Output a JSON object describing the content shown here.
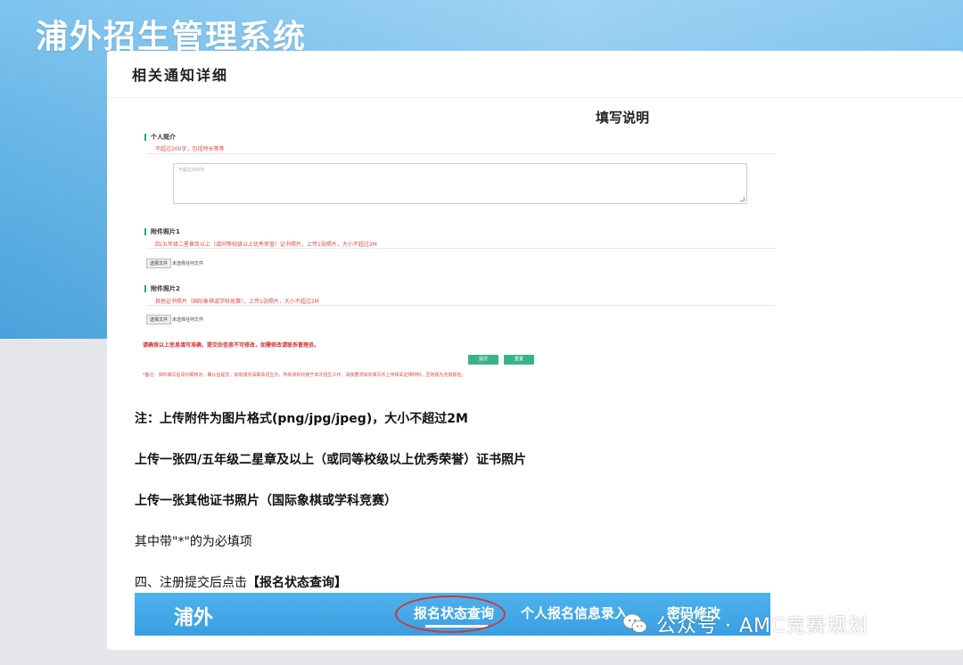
{
  "app": {
    "system_title": "浦外招生管理系统"
  },
  "panel": {
    "header": "相关通知详细",
    "section_title": "填写说明"
  },
  "form": {
    "intro_label": "个人简介",
    "intro_hint": "不超过200字，包括特长等等",
    "intro_placeholder": "不超过200字",
    "photo1_label": "附件照片1",
    "photo1_hint": "四/五年级二星章及以上（或同等校级以上优秀荣誉）证书照片，上传1张照片，大小不超过2M",
    "photo1_file_button": "选择文件",
    "photo1_file_text": "未选择任何文件",
    "photo2_label": "附件照片2",
    "photo2_hint": "其他证书照片（国际象棋或学科竞赛），上传1张照片，大小不超过2M",
    "photo2_file_button": "选择文件",
    "photo2_file_text": "未选择任何文件",
    "warning": "请确保以上信息填写准确，提交后信息不可修改，如需修改请联系管理员。",
    "submit_label": "提交",
    "reset_label": "重置",
    "footnote": "*备注：资料填写后请仔细核对，确认后提交，如有疑问请联系招生办，所有资料仅用于本次招生工作，请按要求如实填写并上传相关证明材料，否则视为无效报名。"
  },
  "notes": {
    "line1": "注：上传附件为图片格式(png/jpg/jpeg)，大小不超过2M",
    "line2": "上传一张四/五年级二星章及以上（或同等校级以上优秀荣誉）证书照片",
    "line3": "上传一张其他证书照片（国际象棋或学科竞赛）",
    "line4": "其中带\"*\"的为必填项",
    "line5_prefix": "四、注册提交后点击",
    "line5_bold": "【报名状态查询】"
  },
  "navbar": {
    "logo": "浦外",
    "items": [
      "报名状态查询",
      "个人报名信息录入",
      "密码修改"
    ]
  },
  "watermark": {
    "text": "公众号 · AMC竞赛规划"
  },
  "colors": {
    "accent_green": "#2aa876",
    "hint_red": "#e04848",
    "nav_blue": "#3a9fe2",
    "circle_red": "#c73b3b"
  }
}
